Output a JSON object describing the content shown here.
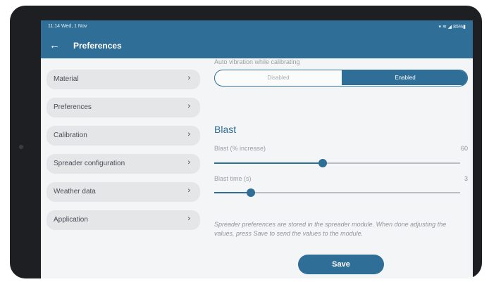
{
  "status_bar": {
    "time": "11:14  Wed, 1 Nov",
    "indicators": "▾ ≋ ◢ 85%▮"
  },
  "app_bar": {
    "title": "Preferences"
  },
  "sidebar": {
    "items": [
      {
        "label": "Material"
      },
      {
        "label": "Preferences"
      },
      {
        "label": "Calibration"
      },
      {
        "label": "Spreader configuration"
      },
      {
        "label": "Weather data"
      },
      {
        "label": "Application"
      }
    ]
  },
  "auto_vibration": {
    "label": "Auto vibration while calibrating",
    "options": [
      "Disabled",
      "Enabled"
    ],
    "selected": "Enabled"
  },
  "blast": {
    "title": "Blast",
    "increase": {
      "label": "Blast (% increase)",
      "value": "60",
      "fraction": 0.44
    },
    "time": {
      "label": "Blast time (s)",
      "value": "3",
      "fraction": 0.15
    }
  },
  "note": "Spreader preferences are stored in the spreader module. When done adjusting the values, press Save to send the values to the module.",
  "actions": {
    "save_label": "Save"
  },
  "colors": {
    "primary": "#2e6e97",
    "background": "#f4f5f6",
    "sidebar_item": "#e4e6e8"
  }
}
